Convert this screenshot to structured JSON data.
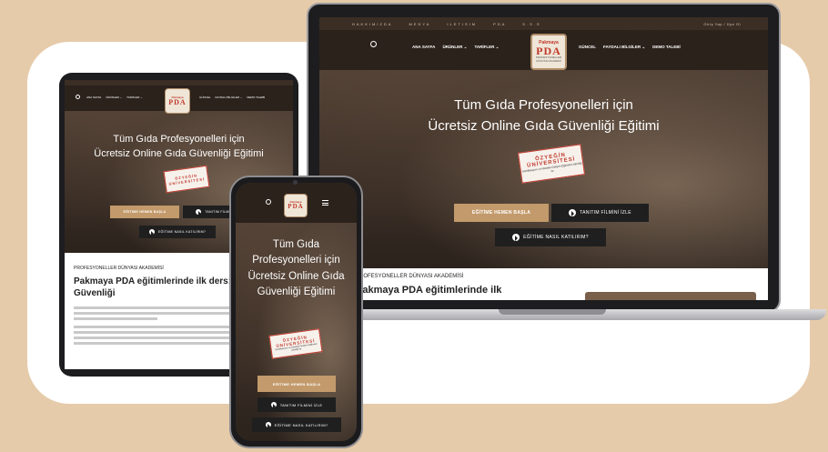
{
  "topbar": {
    "links": [
      "HAKKIMIZDA",
      "MEDYA",
      "ILETISIM",
      "PDA",
      "S.S.S"
    ],
    "right_text": "Giriş Yap / Üye Ol"
  },
  "nav": {
    "left_items": [
      "ANA SAYFA",
      "ÜRÜNLER ⌄",
      "TARİFLER ⌄"
    ],
    "right_items": [
      "GÜNCEL",
      "FAYDALI BİLGİLER ⌄",
      "DEMO TALEBİ"
    ],
    "search_icon": "search-icon",
    "menu_icon": "hamburger-menu-icon"
  },
  "logo": {
    "top": "Pakmaya",
    "main": "PDA",
    "sub": "PROFESYONELLER DÜNYASI AKADEMİ"
  },
  "hero": {
    "title_line1": "Tüm Gıda Profesyonelleri için",
    "title_line2": "Ücretsiz Online Gıda Güvenliği Eğitimi",
    "phone_title_lines": [
      "Tüm Gıda",
      "Profesyonelleri için",
      "Ücretsiz Online Gıda",
      "Güvenliği Eğitimi"
    ]
  },
  "stamp": {
    "line1": "ÖZYEĞİN",
    "line2": "ÜNİVERSİTESİ",
    "line3": "Sertifikasyon ve Mesleki Gelişim Eğitimleri İşbirliği ile"
  },
  "buttons": {
    "start": "EĞİTİME HEMEN BAŞLA",
    "video": "TANITIM FİLMİNİ İZLE",
    "how": "EĞİTİME NASIL KATILIRIM?"
  },
  "article": {
    "eyebrow": "PROFESYONELLER DÜNYASI AKADEMİSİ",
    "title_short": "Pakmaya PDA eğitimlerinde ilk",
    "title_tablet": "Pakmaya PDA eğitimlerinde ilk ders: Gıda Güvenliği"
  },
  "colors": {
    "background": "#e6cbaa",
    "accent": "#c39a6b",
    "brand_red": "#c0392b",
    "dark_button": "#1f1f1f"
  }
}
